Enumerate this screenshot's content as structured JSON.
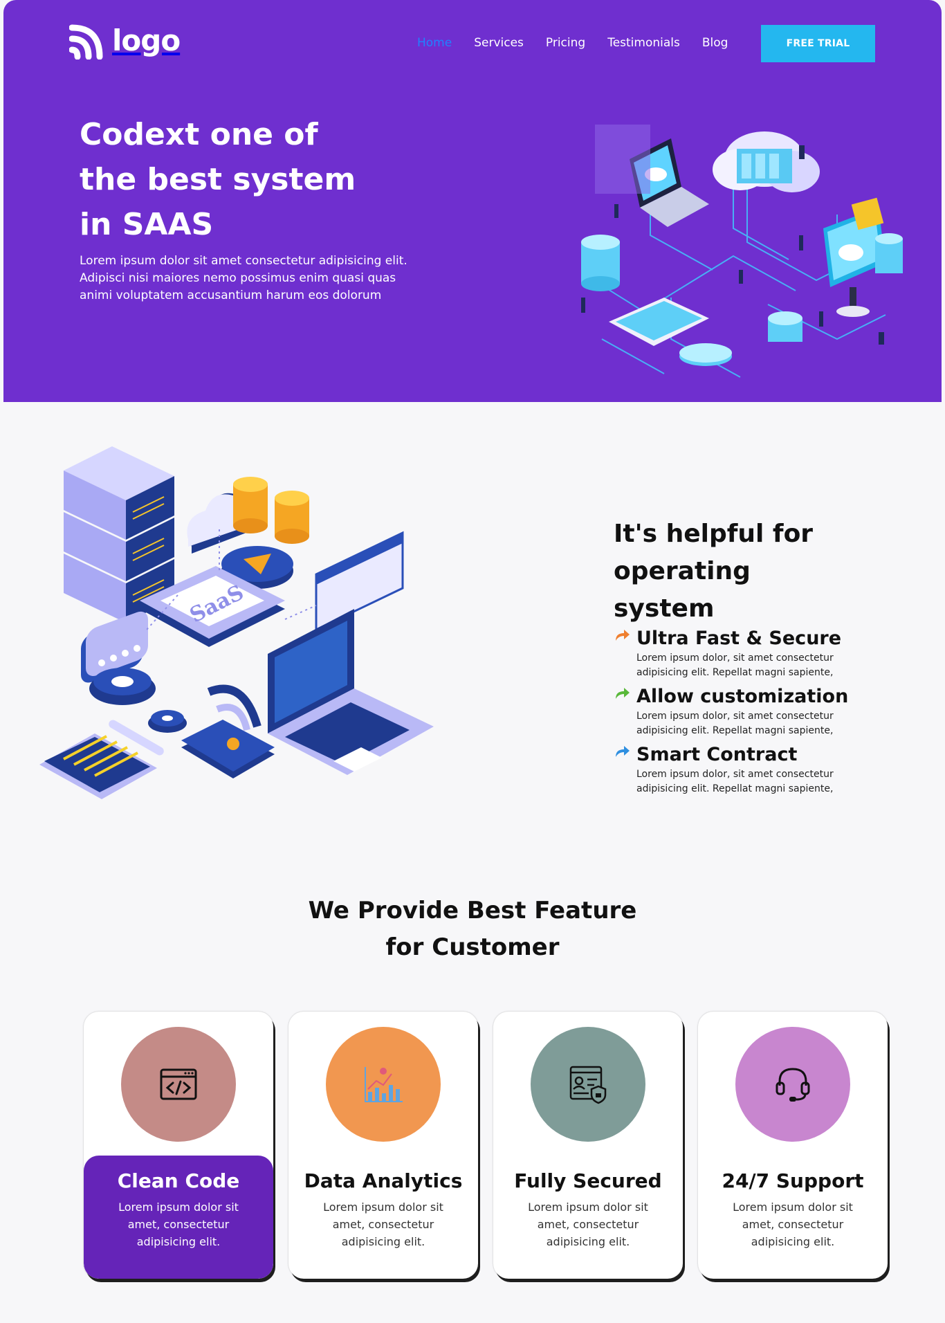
{
  "header": {
    "logo_text": "logo",
    "nav": [
      "Home",
      "Services",
      "Pricing",
      "Testimonials",
      "Blog"
    ],
    "active_nav": "Home",
    "cta_label": "FREE TRIAL"
  },
  "hero": {
    "title_lines": [
      "Codext one of",
      "the best system",
      "in SAAS"
    ],
    "description": "Lorem ipsum dolor sit amet consectetur adipisicing elit. Adipisci nisi maiores nemo possimus enim quasi quas animi voluptatem accusantium harum eos dolorum",
    "illustration": "isometric-cloud-network-illustration"
  },
  "section2": {
    "illustration": "isometric-saas-illustration",
    "illustration_text": "SaaS",
    "title_lines": [
      "It's helpful for operating",
      "system"
    ],
    "features": [
      {
        "title": "Ultra Fast & Secure",
        "desc_lines": [
          "Lorem ipsum dolor, sit amet consectetur",
          "adipisicing elit. Repellat magni sapiente,"
        ],
        "arrow_color": "#ef7f2f"
      },
      {
        "title": "Allow customization",
        "desc_lines": [
          "Lorem ipsum dolor, sit amet consectetur",
          "adipisicing elit. Repellat magni sapiente,"
        ],
        "arrow_color": "#59b83a"
      },
      {
        "title": "Smart Contract",
        "desc_lines": [
          "Lorem ipsum dolor, sit amet consectetur",
          "adipisicing elit. Repellat magni sapiente,"
        ],
        "arrow_color": "#2f8fe0"
      }
    ]
  },
  "section3": {
    "title_lines": [
      "We Provide Best Feature",
      "for Customer"
    ],
    "cards": [
      {
        "title": "Clean Code",
        "desc_lines": [
          "Lorem ipsum dolor sit",
          "amet, consectetur",
          "adipisicing elit."
        ],
        "icon": "code-window-icon",
        "circle_color": "#c48b87",
        "featured": true
      },
      {
        "title": "Data Analytics",
        "desc_lines": [
          "Lorem ipsum dolor sit",
          "amet, consectetur",
          "adipisicing elit."
        ],
        "icon": "analytics-chart-icon",
        "circle_color": "#f19750",
        "featured": false
      },
      {
        "title": "Fully Secured",
        "desc_lines": [
          "Lorem ipsum dolor sit",
          "amet, consectetur",
          "adipisicing elit."
        ],
        "icon": "secure-document-icon",
        "circle_color": "#7f9c98",
        "featured": false
      },
      {
        "title": "24/7 Support",
        "desc_lines": [
          "Lorem ipsum dolor sit",
          "amet, consectetur",
          "adipisicing elit."
        ],
        "icon": "headset-icon",
        "circle_color": "#c886cf",
        "featured": false
      }
    ]
  },
  "colors": {
    "hero_bg": "#6f2fcf",
    "cta_bg": "#24b7ef",
    "active_nav": "#1f83ff",
    "featured_card": "#6524b8"
  }
}
